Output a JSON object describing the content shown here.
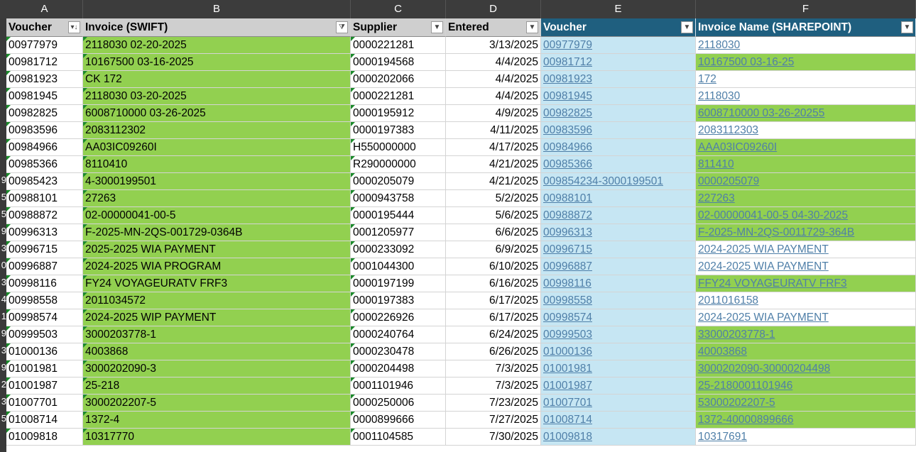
{
  "column_letters": [
    "A",
    "B",
    "C",
    "D",
    "E",
    "F"
  ],
  "headers": {
    "voucher": "Voucher",
    "invoice_swift": "Invoice (SWIFT)",
    "supplier": "Supplier",
    "entered": "Entered",
    "voucher_sp": "Voucher",
    "invoice_name_sp": "Invoice Name (SHAREPOINT)"
  },
  "row_number_fragments": [
    "",
    "",
    "",
    "",
    "",
    "",
    "",
    "",
    "",
    "9",
    "5",
    "5",
    "9",
    "3",
    "0",
    "3",
    "4",
    "1",
    "9",
    "3",
    "9",
    "2",
    "3",
    "5"
  ],
  "rows": [
    {
      "voucher": "00977979",
      "invoice": "2118030 02-20-2025",
      "supplier": "0000221281",
      "entered": "3/13/2025",
      "voucher_sp": "00977979",
      "invoice_sp": "2118030",
      "f_green": false
    },
    {
      "voucher": "00981712",
      "invoice": "10167500 03-16-2025",
      "supplier": "0000194568",
      "entered": "4/4/2025",
      "voucher_sp": "00981712",
      "invoice_sp": "10167500 03-16-25",
      "f_green": true
    },
    {
      "voucher": "00981923",
      "invoice": "CK 172",
      "supplier": "0000202066",
      "entered": "4/4/2025",
      "voucher_sp": "00981923",
      "invoice_sp": "172",
      "f_green": false
    },
    {
      "voucher": "00981945",
      "invoice": "2118030 03-20-2025",
      "supplier": "0000221281",
      "entered": "4/4/2025",
      "voucher_sp": "00981945",
      "invoice_sp": "2118030",
      "f_green": false
    },
    {
      "voucher": "00982825",
      "invoice": "6008710000 03-26-2025",
      "supplier": "0000195912",
      "entered": "4/9/2025",
      "voucher_sp": "00982825",
      "invoice_sp": "6008710000 03-26-20255",
      "f_green": true
    },
    {
      "voucher": "00983596",
      "invoice": "2083112302",
      "supplier": "0000197383",
      "entered": "4/11/2025",
      "voucher_sp": "00983596",
      "invoice_sp": "2083112303",
      "f_green": false
    },
    {
      "voucher": "00984966",
      "invoice": "AA03IC09260I",
      "supplier": "H550000000",
      "entered": "4/17/2025",
      "voucher_sp": "00984966",
      "invoice_sp": "AAA03IC09260I",
      "f_green": true
    },
    {
      "voucher": "00985366",
      "invoice": "8110410",
      "supplier": "R290000000",
      "entered": "4/21/2025",
      "voucher_sp": "00985366",
      "invoice_sp": "811410",
      "f_green": true
    },
    {
      "voucher": "00985423",
      "invoice": "4-3000199501",
      "supplier": "0000205079",
      "entered": "4/21/2025",
      "voucher_sp": "009854234-3000199501",
      "invoice_sp": "0000205079",
      "f_green": true
    },
    {
      "voucher": "00988101",
      "invoice": "27263",
      "supplier": "0000943758",
      "entered": "5/2/2025",
      "voucher_sp": "00988101",
      "invoice_sp": "227263",
      "f_green": true
    },
    {
      "voucher": "00988872",
      "invoice": "02-00000041-00-5",
      "supplier": "0000195444",
      "entered": "5/6/2025",
      "voucher_sp": "00988872",
      "invoice_sp": "02-00000041-00-5 04-30-2025",
      "f_green": true
    },
    {
      "voucher": "00996313",
      "invoice": "F-2025-MN-2QS-001729-0364B",
      "supplier": "0001205977",
      "entered": "6/6/2025",
      "voucher_sp": "00996313",
      "invoice_sp": "F-2025-MN-2QS-0011729-364B",
      "f_green": true
    },
    {
      "voucher": "00996715",
      "invoice": "2025-2025 WIA PAYMENT",
      "supplier": "0000233092",
      "entered": "6/9/2025",
      "voucher_sp": "00996715",
      "invoice_sp": "2024-2025 WIA PAYMENT",
      "f_green": false
    },
    {
      "voucher": "00996887",
      "invoice": "2024-2025 WIA PROGRAM",
      "supplier": "0001044300",
      "entered": "6/10/2025",
      "voucher_sp": "00996887",
      "invoice_sp": "2024-2025 WIA PAYMENT",
      "f_green": false
    },
    {
      "voucher": "00998116",
      "invoice": "FY24 VOYAGEURATV FRF3",
      "supplier": "0000197199",
      "entered": "6/16/2025",
      "voucher_sp": "00998116",
      "invoice_sp": "FFY24 VOYAGEURATV FRF3",
      "f_green": true
    },
    {
      "voucher": "00998558",
      "invoice": "2011034572",
      "supplier": "0000197383",
      "entered": "6/17/2025",
      "voucher_sp": "00998558",
      "invoice_sp": "2011016158",
      "f_green": false
    },
    {
      "voucher": "00998574",
      "invoice": "2024-2025 WIP PAYMENT",
      "supplier": "0000226926",
      "entered": "6/17/2025",
      "voucher_sp": "00998574",
      "invoice_sp": "2024-2025 WIA PAYMENT",
      "f_green": false
    },
    {
      "voucher": "00999503",
      "invoice": "3000203778-1",
      "supplier": "0000240764",
      "entered": "6/24/2025",
      "voucher_sp": "00999503",
      "invoice_sp": "33000203778-1",
      "f_green": true
    },
    {
      "voucher": "01000136",
      "invoice": "4003868",
      "supplier": "0000230478",
      "entered": "6/26/2025",
      "voucher_sp": "01000136",
      "invoice_sp": "40003868",
      "f_green": true
    },
    {
      "voucher": "01001981",
      "invoice": "3000202090-3",
      "supplier": "0000204498",
      "entered": "7/3/2025",
      "voucher_sp": "01001981",
      "invoice_sp": "3000202090-30000204498",
      "f_green": true
    },
    {
      "voucher": "01001987",
      "invoice": "25-218",
      "supplier": "0001101946",
      "entered": "7/3/2025",
      "voucher_sp": "01001987",
      "invoice_sp": "25-2180001101946",
      "f_green": true
    },
    {
      "voucher": "01007701",
      "invoice": "3000202207-5",
      "supplier": "0000250006",
      "entered": "7/23/2025",
      "voucher_sp": "01007701",
      "invoice_sp": "53000202207-5",
      "f_green": true
    },
    {
      "voucher": "01008714",
      "invoice": "1372-4",
      "supplier": "0000899666",
      "entered": "7/27/2025",
      "voucher_sp": "01008714",
      "invoice_sp": "1372-40000899666",
      "f_green": true
    },
    {
      "voucher": "01009818",
      "invoice": "10317770",
      "supplier": "0001104585",
      "entered": "7/30/2025",
      "voucher_sp": "01009818",
      "invoice_sp": "10317691",
      "f_green": false
    }
  ],
  "colors": {
    "invoice_fill": "#92d050",
    "sharepoint_voucher_fill": "#c6e6f3",
    "sharepoint_header": "#1f5f7f",
    "link_text": "#4f7fa8"
  },
  "icons": {
    "sort_filter": "sort-filter-icon",
    "filter_active": "filter-active-icon",
    "dropdown": "dropdown-icon"
  }
}
